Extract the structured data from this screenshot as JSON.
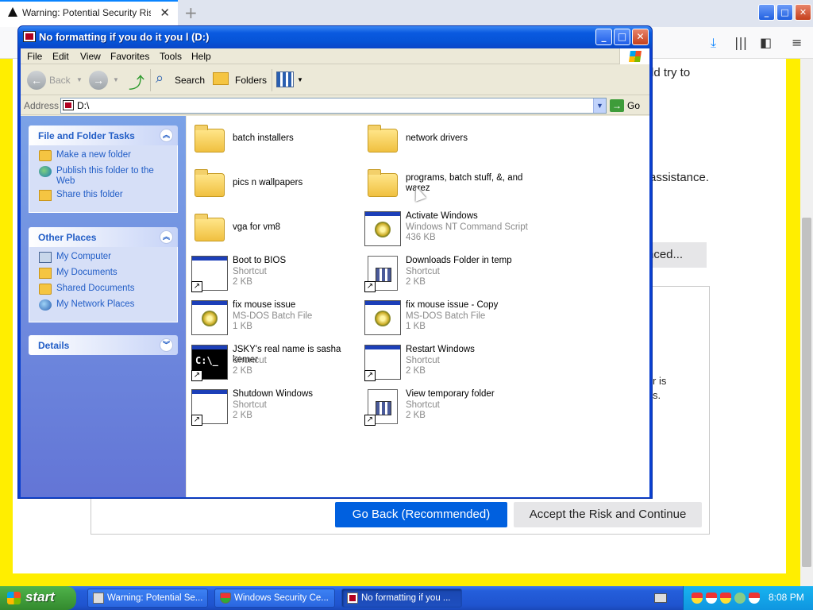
{
  "browser": {
    "tab_title": "Warning: Potential Security Risk Ahead",
    "text_snippet_1": "ld try to",
    "text_snippet_2": "assistance.",
    "advanced_label": "nced...",
    "text_snippet_3": "r is",
    "text_snippet_4": "s.",
    "go_back_label": "Go Back (Recommended)",
    "accept_label": "Accept the Risk and Continue",
    "accent_color": "#0060df",
    "warning_color": "#ffee00"
  },
  "explorer": {
    "title": "No formatting if you do it you l (D:)",
    "menu": [
      "File",
      "Edit",
      "View",
      "Favorites",
      "Tools",
      "Help"
    ],
    "toolbar": {
      "back": "Back",
      "search": "Search",
      "folders": "Folders"
    },
    "address": {
      "label": "Address",
      "value": "D:\\",
      "go": "Go"
    },
    "tasks": {
      "file_folder": {
        "title": "File and Folder Tasks",
        "items": [
          "Make a new folder",
          "Publish this folder to the Web",
          "Share this folder"
        ]
      },
      "other_places": {
        "title": "Other Places",
        "items": [
          "My Computer",
          "My Documents",
          "Shared Documents",
          "My Network Places"
        ]
      },
      "details": {
        "title": "Details"
      }
    },
    "files": [
      {
        "name": "batch installers",
        "type": "",
        "size": "",
        "icon": "folder-icon"
      },
      {
        "name": "network drivers",
        "type": "",
        "size": "",
        "icon": "folder-icon"
      },
      {
        "name": "pics n wallpapers",
        "type": "",
        "size": "",
        "icon": "folder-icon"
      },
      {
        "name": "programs, batch stuff, &, and warez",
        "type": "",
        "size": "",
        "icon": "folder-icon"
      },
      {
        "name": "vga for vm8",
        "type": "",
        "size": "",
        "icon": "folder-icon"
      },
      {
        "name": "Activate Windows",
        "type": "Windows NT Command Script",
        "size": "436 KB",
        "icon": "batch-file-icon"
      },
      {
        "name": "Boot to BIOS",
        "type": "Shortcut",
        "size": "2 KB",
        "icon": "shortcut-window-icon"
      },
      {
        "name": "Downloads Folder in temp",
        "type": "Shortcut",
        "size": "2 KB",
        "icon": "shortcut-document-icon"
      },
      {
        "name": "fix mouse issue",
        "type": "MS-DOS Batch File",
        "size": "1 KB",
        "icon": "batch-file-icon"
      },
      {
        "name": "fix mouse issue - Copy",
        "type": "MS-DOS Batch File",
        "size": "1 KB",
        "icon": "batch-file-icon"
      },
      {
        "name": "JSKY's real name is sasha kemer",
        "type": "Shortcut",
        "size": "2 KB",
        "icon": "shortcut-cmd-icon"
      },
      {
        "name": "Restart Windows",
        "type": "Shortcut",
        "size": "2 KB",
        "icon": "shortcut-window-icon"
      },
      {
        "name": "Shutdown Windows",
        "type": "Shortcut",
        "size": "2 KB",
        "icon": "shortcut-window-icon"
      },
      {
        "name": "View temporary folder",
        "type": "Shortcut",
        "size": "2 KB",
        "icon": "shortcut-document-icon"
      }
    ]
  },
  "taskbar": {
    "start": "start",
    "tasks": [
      "Warning: Potential Se...",
      "Windows Security Ce...",
      "No formatting if you ..."
    ],
    "clock": "8:08 PM"
  }
}
